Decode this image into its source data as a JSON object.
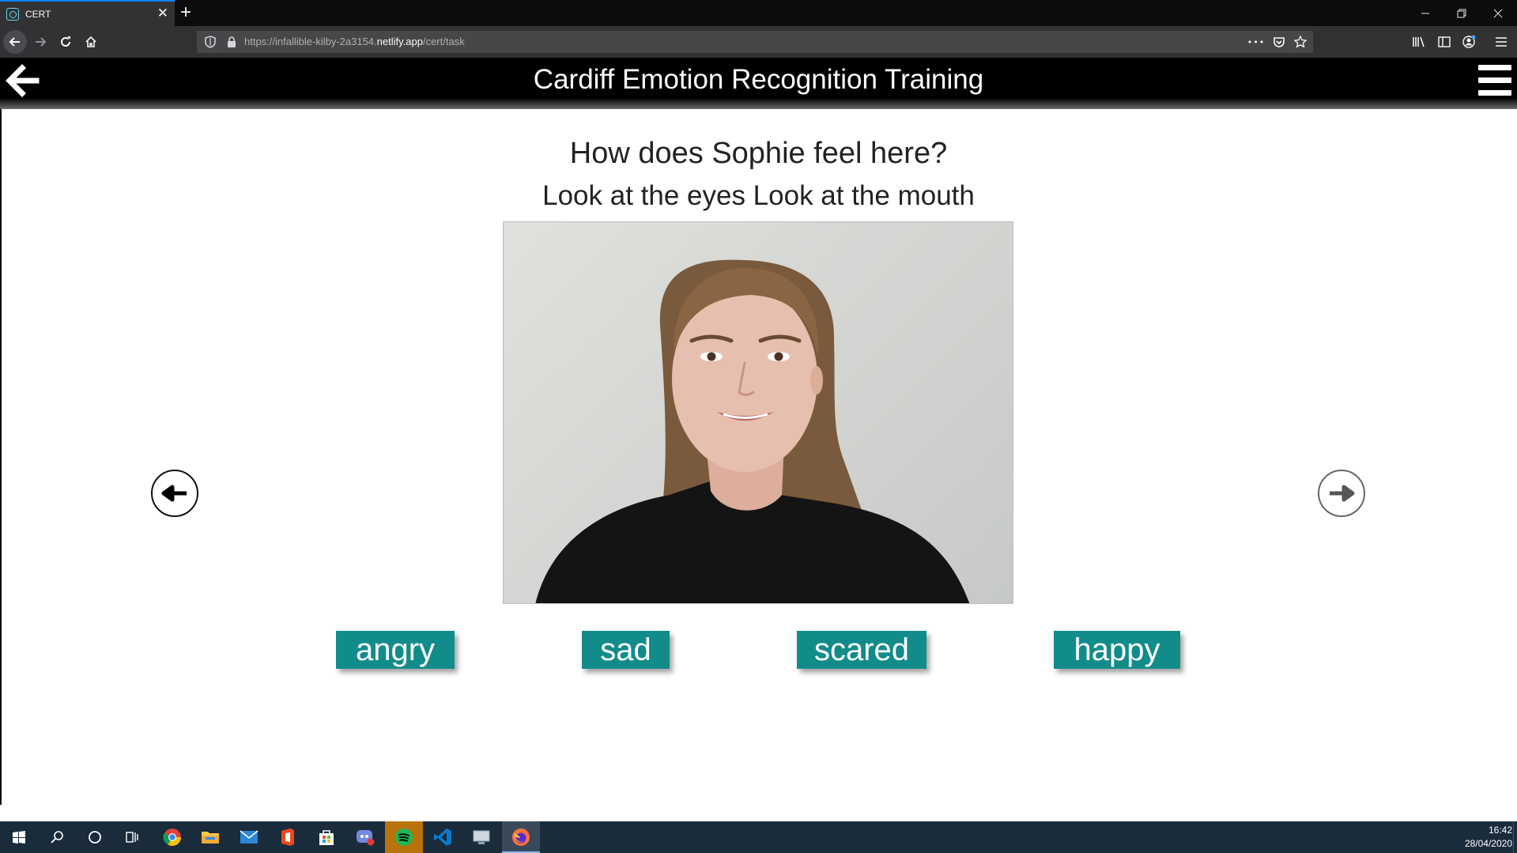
{
  "browser": {
    "tab_title": "CERT",
    "url_prefix": "https://infallible-kilby-2a3154.",
    "url_host": "netlify.app",
    "url_path": "/cert/task",
    "close_glyph": "✕",
    "newtab_glyph": "+",
    "more_glyph": "•••"
  },
  "app": {
    "title": "Cardiff Emotion Recognition Training"
  },
  "task": {
    "question": "How does Sophie feel here?",
    "hint": "Look at the eyes Look at the mouth",
    "answers": [
      {
        "label": "angry"
      },
      {
        "label": "sad"
      },
      {
        "label": "scared"
      },
      {
        "label": "happy"
      }
    ]
  },
  "taskbar": {
    "time": "16:42",
    "date": "28/04/2020",
    "icons": [
      "windows-start-icon",
      "search-icon",
      "cortana-icon",
      "task-view-icon",
      "chrome-icon",
      "file-explorer-icon",
      "mail-icon",
      "office-icon",
      "store-icon",
      "discord-icon",
      "spotify-icon",
      "vscode-icon",
      "remote-desktop-icon",
      "firefox-icon"
    ]
  },
  "colors": {
    "answer_button": "#128c8b",
    "header_bg": "#000000",
    "browser_chrome": "#323234"
  }
}
